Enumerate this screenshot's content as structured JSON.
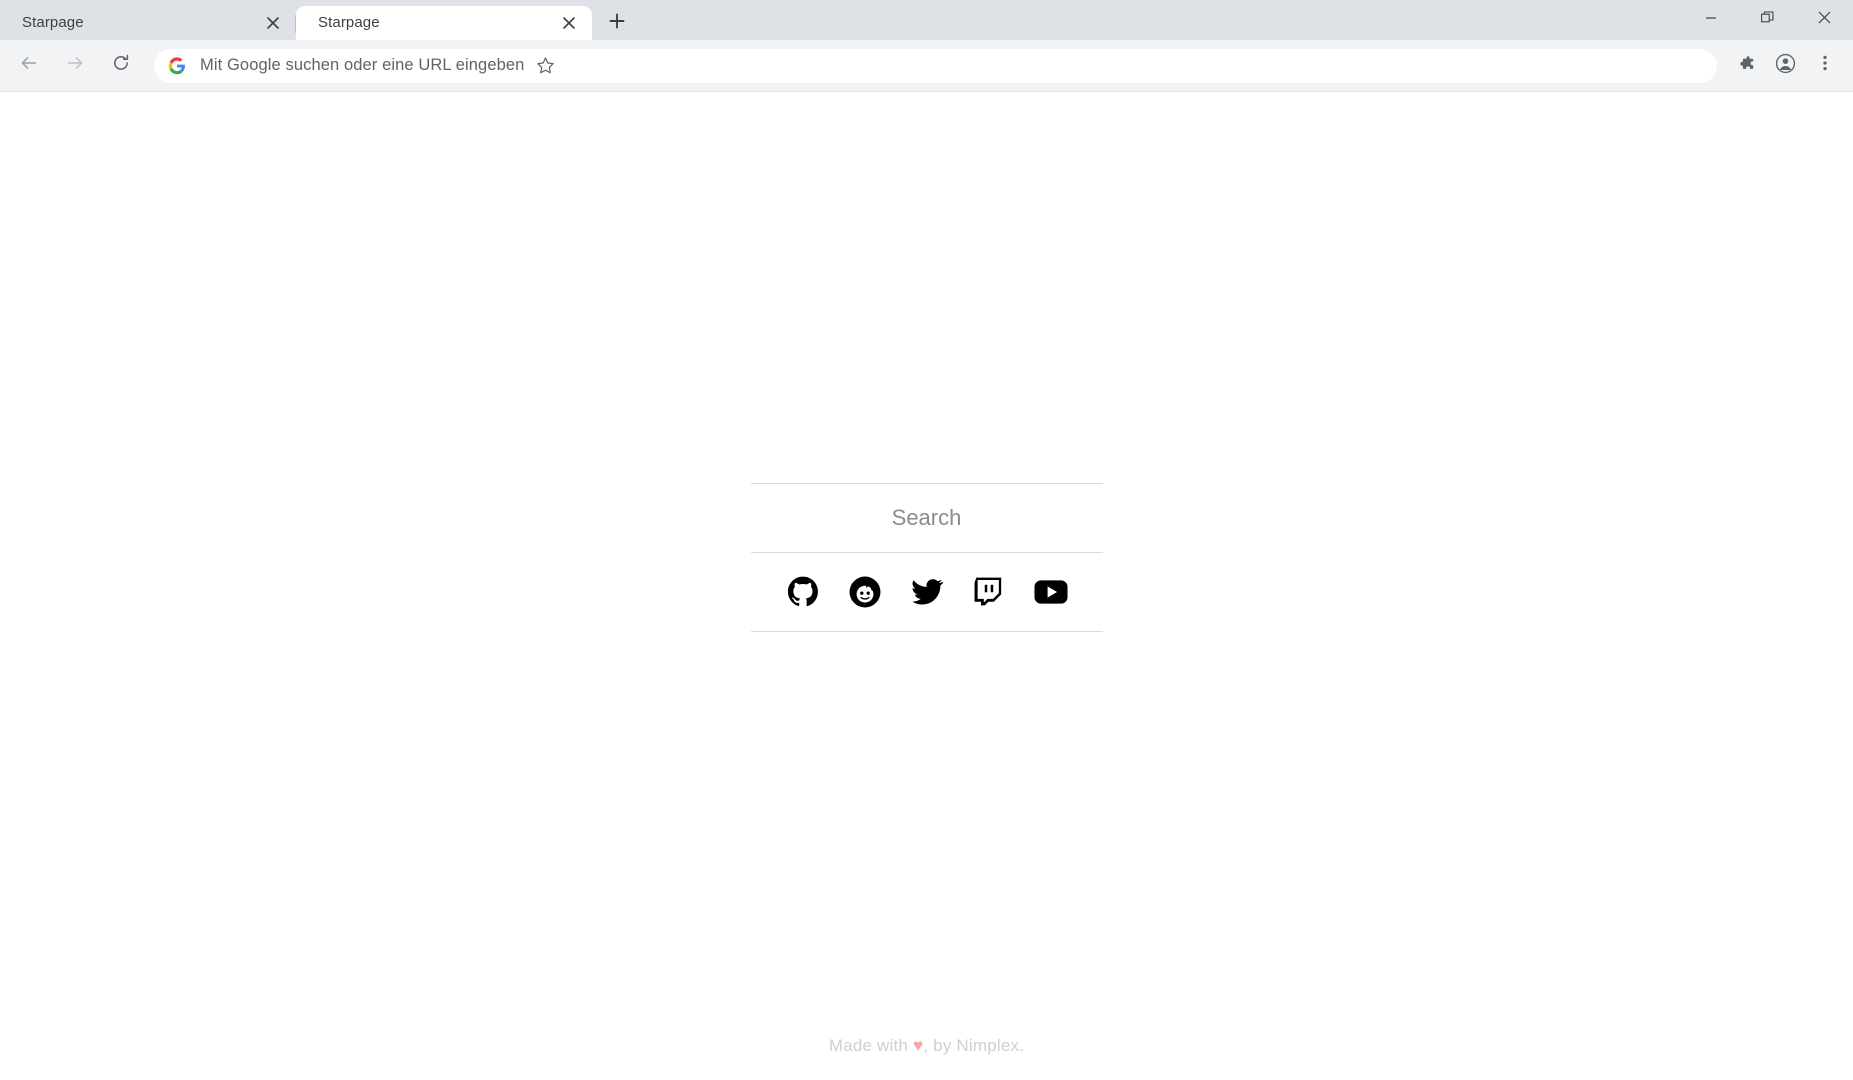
{
  "window": {
    "controls": [
      {
        "name": "minimize",
        "label": "Minimize"
      },
      {
        "name": "restore",
        "label": "Restore"
      },
      {
        "name": "close",
        "label": "Close"
      }
    ]
  },
  "tabstrip": {
    "tabs": [
      {
        "title": "Starpage",
        "active": false,
        "close_label": "Close tab"
      },
      {
        "title": "Starpage",
        "active": true,
        "close_label": "Close tab"
      }
    ],
    "new_tab_label": "New tab"
  },
  "toolbar": {
    "back_label": "Back",
    "forward_label": "Forward",
    "reload_label": "Reload",
    "omnibox": {
      "value": "",
      "placeholder": "Mit Google suchen oder eine URL eingeben",
      "search_engine_icon": "google-g-icon",
      "bookmark_label": "Bookmark this tab"
    },
    "extensions_label": "Extensions",
    "profile_label": "Profile",
    "menu_label": "Customize and control Google Chrome"
  },
  "page": {
    "search": {
      "value": "",
      "placeholder": "Search"
    },
    "links": [
      {
        "name": "github",
        "label": "GitHub"
      },
      {
        "name": "reddit",
        "label": "Reddit"
      },
      {
        "name": "twitter",
        "label": "Twitter"
      },
      {
        "name": "twitch",
        "label": "Twitch"
      },
      {
        "name": "youtube",
        "label": "YouTube"
      }
    ],
    "footer": {
      "prefix": "Made with ",
      "heart": "♥",
      "suffix": ", by Nimplex."
    }
  },
  "colors": {
    "tabstrip_bg": "#dee1e6",
    "toolbar_bg": "#f1f3f4",
    "omnibox_bg": "#ffffff",
    "page_bg": "#ffffff",
    "divider": "#dcdcdc",
    "placeholder_text": "#8b8b8b",
    "footer_text": "#cfcfcf",
    "heart": "#f9a3a7",
    "icon_black": "#000000"
  }
}
